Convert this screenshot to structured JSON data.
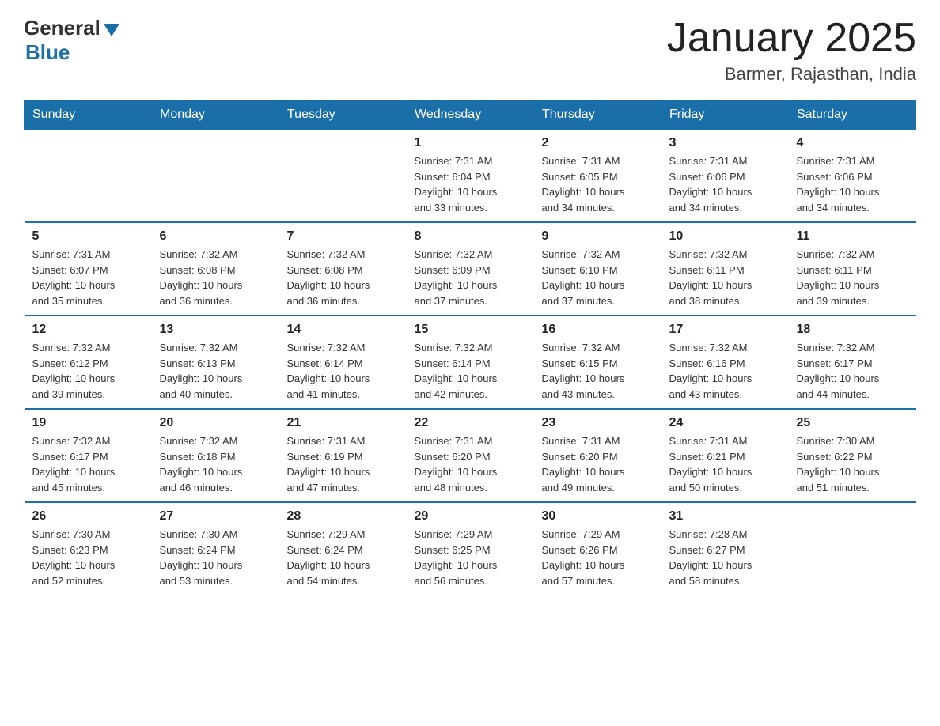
{
  "logo": {
    "general": "General",
    "blue": "Blue"
  },
  "title": "January 2025",
  "location": "Barmer, Rajasthan, India",
  "days_of_week": [
    "Sunday",
    "Monday",
    "Tuesday",
    "Wednesday",
    "Thursday",
    "Friday",
    "Saturday"
  ],
  "weeks": [
    [
      {
        "day": "",
        "info": ""
      },
      {
        "day": "",
        "info": ""
      },
      {
        "day": "",
        "info": ""
      },
      {
        "day": "1",
        "info": "Sunrise: 7:31 AM\nSunset: 6:04 PM\nDaylight: 10 hours\nand 33 minutes."
      },
      {
        "day": "2",
        "info": "Sunrise: 7:31 AM\nSunset: 6:05 PM\nDaylight: 10 hours\nand 34 minutes."
      },
      {
        "day": "3",
        "info": "Sunrise: 7:31 AM\nSunset: 6:06 PM\nDaylight: 10 hours\nand 34 minutes."
      },
      {
        "day": "4",
        "info": "Sunrise: 7:31 AM\nSunset: 6:06 PM\nDaylight: 10 hours\nand 34 minutes."
      }
    ],
    [
      {
        "day": "5",
        "info": "Sunrise: 7:31 AM\nSunset: 6:07 PM\nDaylight: 10 hours\nand 35 minutes."
      },
      {
        "day": "6",
        "info": "Sunrise: 7:32 AM\nSunset: 6:08 PM\nDaylight: 10 hours\nand 36 minutes."
      },
      {
        "day": "7",
        "info": "Sunrise: 7:32 AM\nSunset: 6:08 PM\nDaylight: 10 hours\nand 36 minutes."
      },
      {
        "day": "8",
        "info": "Sunrise: 7:32 AM\nSunset: 6:09 PM\nDaylight: 10 hours\nand 37 minutes."
      },
      {
        "day": "9",
        "info": "Sunrise: 7:32 AM\nSunset: 6:10 PM\nDaylight: 10 hours\nand 37 minutes."
      },
      {
        "day": "10",
        "info": "Sunrise: 7:32 AM\nSunset: 6:11 PM\nDaylight: 10 hours\nand 38 minutes."
      },
      {
        "day": "11",
        "info": "Sunrise: 7:32 AM\nSunset: 6:11 PM\nDaylight: 10 hours\nand 39 minutes."
      }
    ],
    [
      {
        "day": "12",
        "info": "Sunrise: 7:32 AM\nSunset: 6:12 PM\nDaylight: 10 hours\nand 39 minutes."
      },
      {
        "day": "13",
        "info": "Sunrise: 7:32 AM\nSunset: 6:13 PM\nDaylight: 10 hours\nand 40 minutes."
      },
      {
        "day": "14",
        "info": "Sunrise: 7:32 AM\nSunset: 6:14 PM\nDaylight: 10 hours\nand 41 minutes."
      },
      {
        "day": "15",
        "info": "Sunrise: 7:32 AM\nSunset: 6:14 PM\nDaylight: 10 hours\nand 42 minutes."
      },
      {
        "day": "16",
        "info": "Sunrise: 7:32 AM\nSunset: 6:15 PM\nDaylight: 10 hours\nand 43 minutes."
      },
      {
        "day": "17",
        "info": "Sunrise: 7:32 AM\nSunset: 6:16 PM\nDaylight: 10 hours\nand 43 minutes."
      },
      {
        "day": "18",
        "info": "Sunrise: 7:32 AM\nSunset: 6:17 PM\nDaylight: 10 hours\nand 44 minutes."
      }
    ],
    [
      {
        "day": "19",
        "info": "Sunrise: 7:32 AM\nSunset: 6:17 PM\nDaylight: 10 hours\nand 45 minutes."
      },
      {
        "day": "20",
        "info": "Sunrise: 7:32 AM\nSunset: 6:18 PM\nDaylight: 10 hours\nand 46 minutes."
      },
      {
        "day": "21",
        "info": "Sunrise: 7:31 AM\nSunset: 6:19 PM\nDaylight: 10 hours\nand 47 minutes."
      },
      {
        "day": "22",
        "info": "Sunrise: 7:31 AM\nSunset: 6:20 PM\nDaylight: 10 hours\nand 48 minutes."
      },
      {
        "day": "23",
        "info": "Sunrise: 7:31 AM\nSunset: 6:20 PM\nDaylight: 10 hours\nand 49 minutes."
      },
      {
        "day": "24",
        "info": "Sunrise: 7:31 AM\nSunset: 6:21 PM\nDaylight: 10 hours\nand 50 minutes."
      },
      {
        "day": "25",
        "info": "Sunrise: 7:30 AM\nSunset: 6:22 PM\nDaylight: 10 hours\nand 51 minutes."
      }
    ],
    [
      {
        "day": "26",
        "info": "Sunrise: 7:30 AM\nSunset: 6:23 PM\nDaylight: 10 hours\nand 52 minutes."
      },
      {
        "day": "27",
        "info": "Sunrise: 7:30 AM\nSunset: 6:24 PM\nDaylight: 10 hours\nand 53 minutes."
      },
      {
        "day": "28",
        "info": "Sunrise: 7:29 AM\nSunset: 6:24 PM\nDaylight: 10 hours\nand 54 minutes."
      },
      {
        "day": "29",
        "info": "Sunrise: 7:29 AM\nSunset: 6:25 PM\nDaylight: 10 hours\nand 56 minutes."
      },
      {
        "day": "30",
        "info": "Sunrise: 7:29 AM\nSunset: 6:26 PM\nDaylight: 10 hours\nand 57 minutes."
      },
      {
        "day": "31",
        "info": "Sunrise: 7:28 AM\nSunset: 6:27 PM\nDaylight: 10 hours\nand 58 minutes."
      },
      {
        "day": "",
        "info": ""
      }
    ]
  ]
}
